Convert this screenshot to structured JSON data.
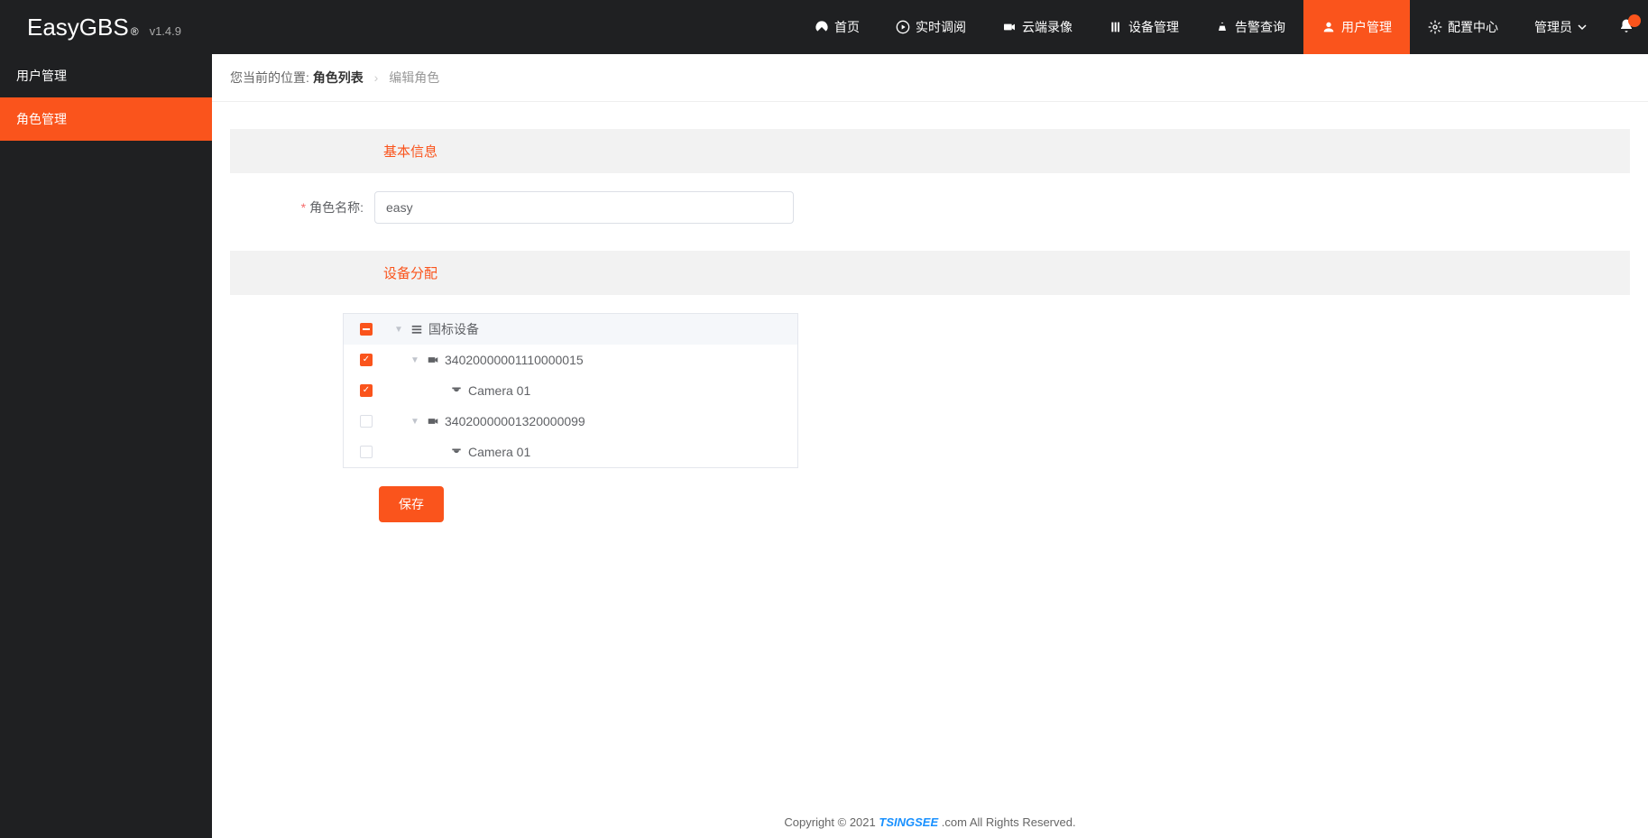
{
  "app": {
    "name": "EasyGBS",
    "reg": "®",
    "version": "v1.4.9"
  },
  "nav": [
    {
      "id": "home",
      "label": "首页",
      "icon": "dashboard"
    },
    {
      "id": "realtime",
      "label": "实时调阅",
      "icon": "play"
    },
    {
      "id": "cloud",
      "label": "云端录像",
      "icon": "video"
    },
    {
      "id": "device",
      "label": "设备管理",
      "icon": "device"
    },
    {
      "id": "alarm",
      "label": "告警查询",
      "icon": "alert"
    },
    {
      "id": "user",
      "label": "用户管理",
      "icon": "user",
      "active": true
    },
    {
      "id": "config",
      "label": "配置中心",
      "icon": "gear"
    }
  ],
  "admin": {
    "label": "管理员"
  },
  "sidebar": [
    {
      "id": "user-mgmt",
      "label": "用户管理"
    },
    {
      "id": "role-mgmt",
      "label": "角色管理",
      "active": true
    }
  ],
  "breadcrumb": {
    "prefix": "您当前的位置:",
    "link": "角色列表",
    "current": "编辑角色"
  },
  "sections": {
    "basic": "基本信息",
    "device": "设备分配"
  },
  "form": {
    "role_name_label": "角色名称:",
    "role_name_value": "easy"
  },
  "tree": [
    {
      "label": "国标设备",
      "level": 0,
      "state": "indeterminate",
      "icon": "list",
      "root": true
    },
    {
      "label": "34020000001110000015",
      "level": 1,
      "state": "checked",
      "icon": "camera"
    },
    {
      "label": "Camera 01",
      "level": 2,
      "state": "checked",
      "icon": "dome"
    },
    {
      "label": "34020000001320000099",
      "level": 1,
      "state": "unchecked",
      "icon": "camera"
    },
    {
      "label": "Camera 01",
      "level": 2,
      "state": "unchecked",
      "icon": "dome"
    }
  ],
  "buttons": {
    "save": "保存"
  },
  "footer": {
    "prefix": "Copyright © 2021 ",
    "brand": "TSINGSEE",
    "suffix": " .com All Rights Reserved."
  }
}
